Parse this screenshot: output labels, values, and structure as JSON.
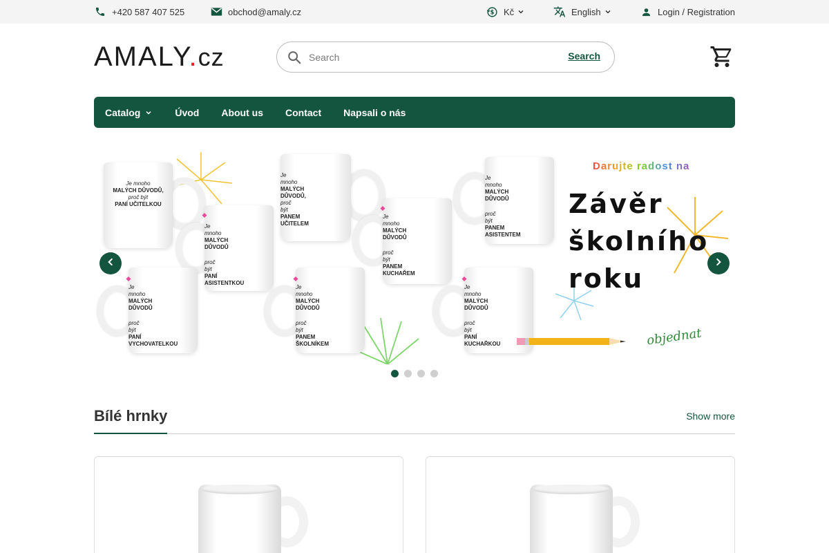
{
  "topbar": {
    "phone": "+420 587 407 525",
    "email": "obchod@amaly.cz",
    "currency": "Kč",
    "language": "English",
    "login": "Login / Registration"
  },
  "header": {
    "logo_main": "AMALY",
    "logo_dot": ".",
    "logo_tld": "cz",
    "search_placeholder": "Search",
    "search_button": "Search"
  },
  "nav": {
    "items": [
      {
        "label": "Catalog"
      },
      {
        "label": "Úvod"
      },
      {
        "label": "About us"
      },
      {
        "label": "Contact"
      },
      {
        "label": "Napsali o nás"
      }
    ]
  },
  "banner": {
    "tagline": "Darujte radost na",
    "headline_1": "Závěr",
    "headline_2": "školního",
    "headline_3": "roku",
    "cta": "objednat",
    "mugs": [
      {
        "lines": [
          "Je mnoho",
          "MALÝCH DŮVODŮ,",
          "proč být",
          "PANÍ UČITELKOU"
        ]
      },
      {
        "lines": [
          "Je mnoho",
          "MALÝCH DŮVODŮ",
          "proč být",
          "PANÍ ASISTENTKOU"
        ]
      },
      {
        "lines": [
          "Je mnoho",
          "MALÝCH DŮVODŮ,",
          "proč být",
          "PANEM UČITELEM"
        ]
      },
      {
        "lines": [
          "Je mnoho",
          "MALÝCH DŮVODŮ",
          "proč být",
          "PANEM KUCHAŘEM"
        ]
      },
      {
        "lines": [
          "Je mnoho",
          "MALÝCH DŮVODŮ",
          "proč být",
          "PANEM ASISTENTEM"
        ]
      },
      {
        "lines": [
          "Je mnoho",
          "MALÝCH DŮVODŮ",
          "proč být",
          "PANÍ VYCHOVATELKOU"
        ]
      },
      {
        "lines": [
          "Je mnoho",
          "MALÝCH DŮVODŮ",
          "proč být",
          "PANEM ŠKOLNÍKEM"
        ]
      },
      {
        "lines": [
          "Je mnoho",
          "MALÝCH DŮVODŮ",
          "proč být",
          "PANÍ KUCHAŘKOU"
        ]
      }
    ],
    "slide_count": 4,
    "active_slide": 1
  },
  "section": {
    "title": "Bílé hrnky",
    "more": "Show more"
  },
  "colors": {
    "brand": "#14553f",
    "logo_dot": "#e0221c"
  },
  "icons": {
    "phone": "phone-icon",
    "email": "mail-icon",
    "currency": "currency-exchange-icon",
    "language": "translate-icon",
    "user": "user-icon",
    "search": "search-icon",
    "cart": "cart-icon"
  }
}
